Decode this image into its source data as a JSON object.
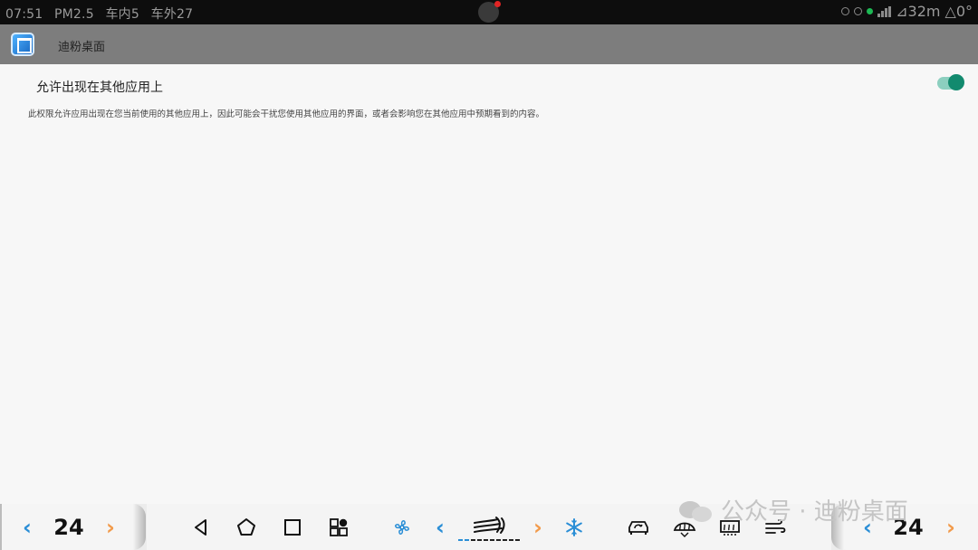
{
  "status_bar": {
    "time": "07:51",
    "pm25": "PM2.5",
    "inside_temp": "车内5",
    "outside_temp": "车外27",
    "distance": "32m",
    "angle": "0°"
  },
  "header": {
    "app_title": "迪粉桌面",
    "app_icon_label": "M3"
  },
  "setting": {
    "title": "允许出现在其他应用上",
    "description": "此权限允许应用出现在您当前使用的其他应用上，因此可能会干扰您使用其他应用的界面，或者会影响您在其他应用中预期看到的内容。",
    "enabled": true
  },
  "bottom_bar": {
    "left_temp": "24",
    "right_temp": "24",
    "watermark": "公众号 · 迪粉桌面"
  },
  "colors": {
    "accent_blue": "#2a8ed6",
    "accent_orange": "#f29a4a",
    "toggle_on": "#128a6e"
  }
}
